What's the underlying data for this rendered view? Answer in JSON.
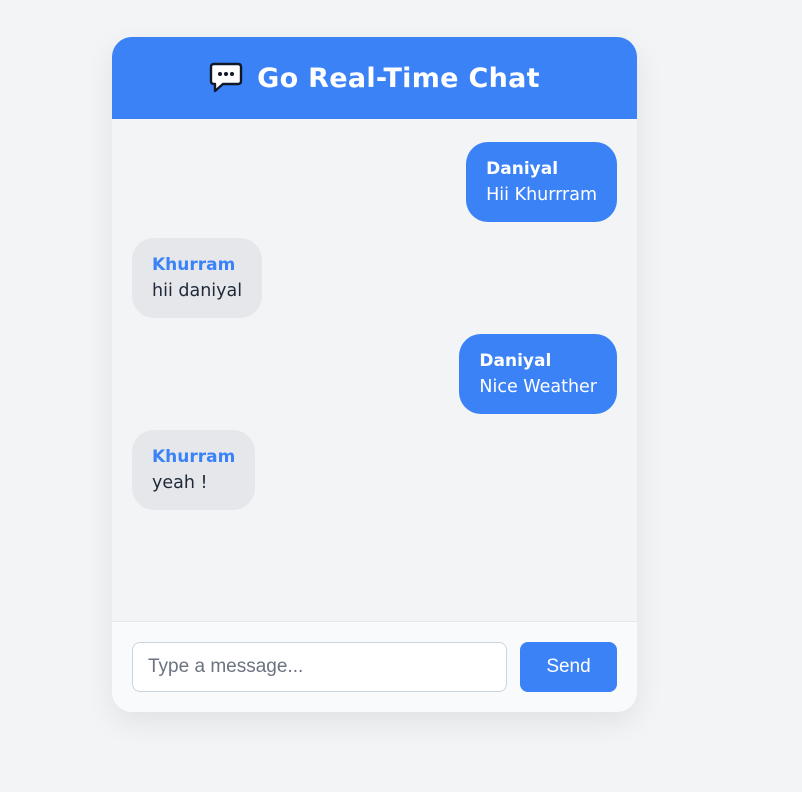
{
  "header": {
    "title": "Go Real-Time Chat",
    "icon": "speech-bubble-icon"
  },
  "messages": [
    {
      "sender": "Daniyal",
      "text": "Hii Khurrram",
      "direction": "sent"
    },
    {
      "sender": "Khurram",
      "text": "hii daniyal",
      "direction": "received"
    },
    {
      "sender": "Daniyal",
      "text": "Nice Weather",
      "direction": "sent"
    },
    {
      "sender": "Khurram",
      "text": "yeah !",
      "direction": "received"
    }
  ],
  "composer": {
    "placeholder": "Type a message...",
    "value": "",
    "send_label": "Send"
  },
  "colors": {
    "accent": "#3b82f6",
    "received_bubble": "#e5e7eb",
    "background": "#f2f4f6"
  }
}
